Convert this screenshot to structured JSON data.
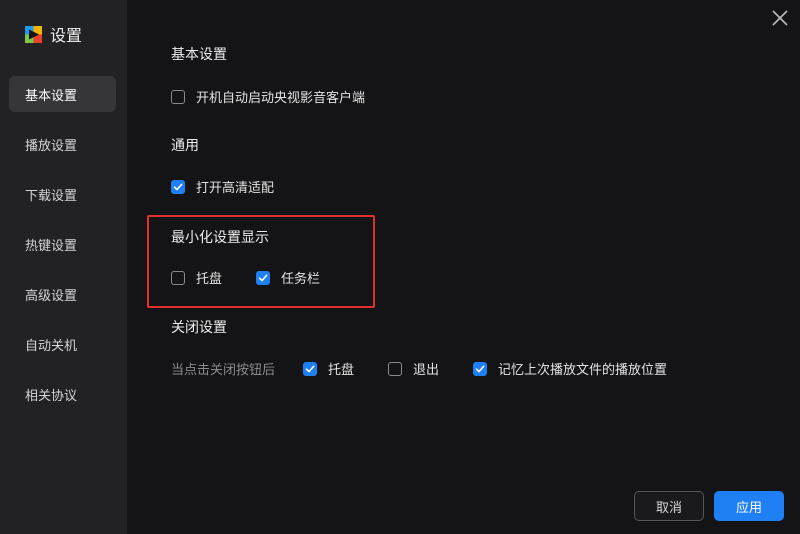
{
  "app": {
    "title": "设置",
    "logo_icon": "tencent-video-logo-icon"
  },
  "sidebar": {
    "items": [
      {
        "label": "基本设置",
        "active": true
      },
      {
        "label": "播放设置",
        "active": false
      },
      {
        "label": "下载设置",
        "active": false
      },
      {
        "label": "热键设置",
        "active": false
      },
      {
        "label": "高级设置",
        "active": false
      },
      {
        "label": "自动关机",
        "active": false
      },
      {
        "label": "相关协议",
        "active": false
      }
    ]
  },
  "sections": {
    "basic": {
      "title": "基本设置",
      "autostart_label": "开机自动启动央视影音客户端",
      "autostart_checked": false
    },
    "general": {
      "title": "通用",
      "hd_label": "打开高清适配",
      "hd_checked": true
    },
    "minimize": {
      "title": "最小化设置显示",
      "tray_label": "托盘",
      "tray_checked": false,
      "taskbar_label": "任务栏",
      "taskbar_checked": true
    },
    "close": {
      "title": "关闭设置",
      "prompt": "当点击关闭按钮后",
      "tray_label": "托盘",
      "tray_checked": true,
      "exit_label": "退出",
      "exit_checked": false,
      "remember_label": "记忆上次播放文件的播放位置",
      "remember_checked": true
    }
  },
  "buttons": {
    "cancel": "取消",
    "apply": "应用"
  },
  "colors": {
    "accent": "#1f7ff5",
    "highlight": "#e0302e",
    "sidebar_bg": "#222225",
    "content_bg": "#141416"
  }
}
